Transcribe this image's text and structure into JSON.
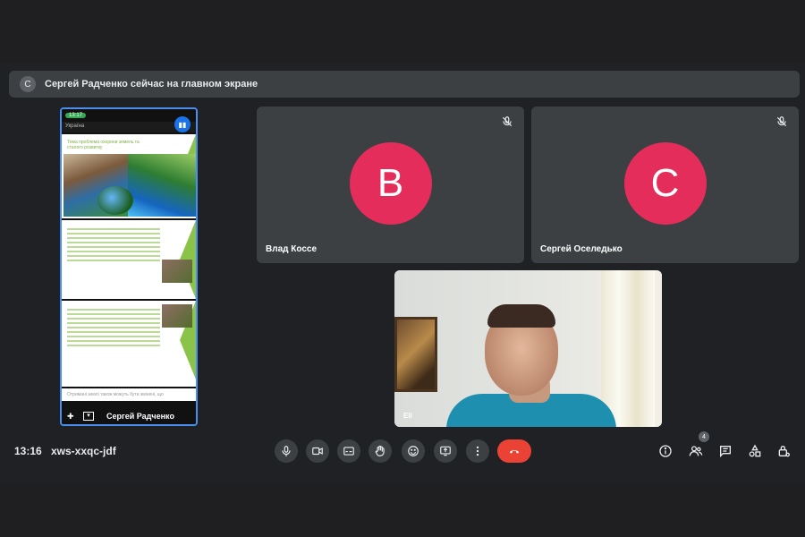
{
  "banner": {
    "avatar_letter": "C",
    "text": "Сергей Радченко сейчас на главном экране"
  },
  "screen_share": {
    "status_time": "13:17",
    "app_title": "Україна",
    "slide1_title": "Тема проблема охорони земель та сталого розвитку",
    "bottom_text": "Отримані землі також можуть бути змінені, що",
    "presenter_name": "Сергей Радченко"
  },
  "tiles": [
    {
      "name": "Влад Коссе",
      "avatar_letter": "B",
      "avatar_color": "#e52d5b",
      "muted": true
    },
    {
      "name": "Сергей Оселедько",
      "avatar_letter": "C",
      "avatar_color": "#e52d5b",
      "muted": true
    }
  ],
  "camera_tile": {
    "name": "Eli"
  },
  "meeting": {
    "time": "13:16",
    "code": "xws-xxqc-jdf",
    "participant_count": "4"
  },
  "controls": {
    "mic": "mic-icon",
    "camera": "videocam-icon",
    "captions": "captions-icon",
    "raise_hand": "hand-icon",
    "reactions": "emoji-icon",
    "present": "present-icon",
    "more": "more-vert-icon",
    "leave": "call-end-icon"
  },
  "colors": {
    "background": "#202124",
    "tile": "#3c4043",
    "avatar": "#e52d5b",
    "end_call": "#ea4335",
    "share_border": "#4a8ff0"
  }
}
